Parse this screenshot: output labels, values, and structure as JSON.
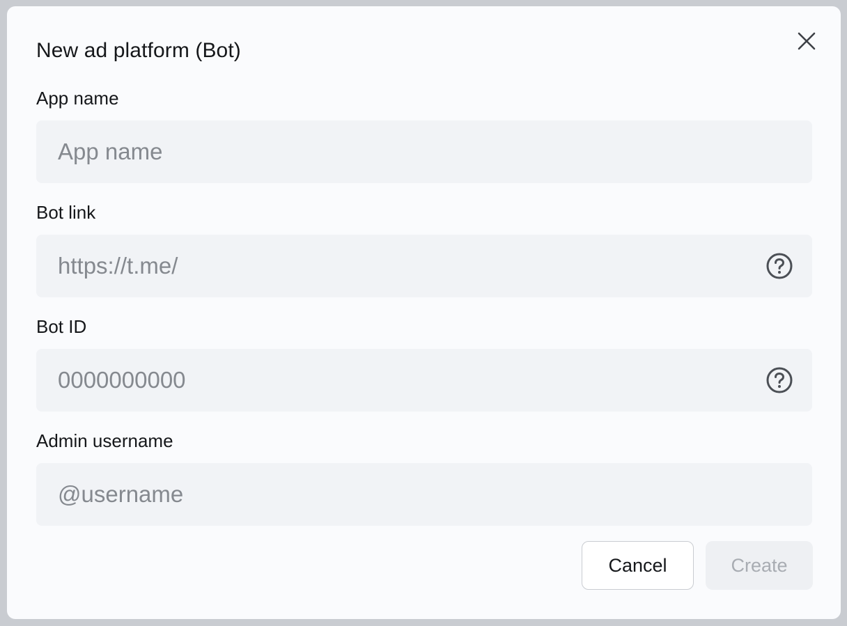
{
  "dialog": {
    "title": "New ad platform (Bot)",
    "close_icon": "close-icon"
  },
  "fields": {
    "app_name": {
      "label": "App name",
      "placeholder": "App name",
      "value": ""
    },
    "bot_link": {
      "label": "Bot link",
      "placeholder": "https://t.me/",
      "value": "",
      "help_icon": "question-circle-icon"
    },
    "bot_id": {
      "label": "Bot ID",
      "placeholder": "0000000000",
      "value": "",
      "help_icon": "question-circle-icon"
    },
    "admin_username": {
      "label": "Admin username",
      "placeholder": "@username",
      "value": ""
    }
  },
  "actions": {
    "cancel_label": "Cancel",
    "create_label": "Create",
    "create_disabled": true
  },
  "colors": {
    "backdrop": "#c9ccd1",
    "dialog_bg": "#fafbfd",
    "input_bg": "#f1f3f6",
    "text": "#15171a",
    "placeholder": "#85898f",
    "disabled_text": "#a8acb2"
  }
}
